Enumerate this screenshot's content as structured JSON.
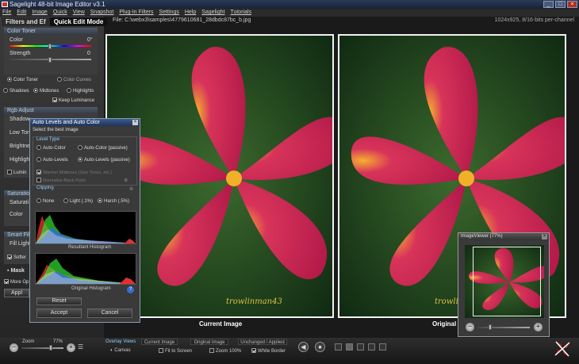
{
  "window": {
    "title": "Sagelight 48-bit Image Editor v3.1",
    "controls": [
      "_",
      "□",
      "×"
    ]
  },
  "menu": [
    "File",
    "Edit",
    "Image",
    "Quick",
    "View",
    "Snapshot",
    "Plug-In Filters",
    "Settings",
    "Help",
    "Sagelight",
    "Tutorials"
  ],
  "file_info": {
    "path": "File: C:\\webx3\\samples\\4779610681_28dbdc87bc_b.jpg",
    "dims": "1024x925, 8/16-bits per-channel"
  },
  "panel": {
    "tabs": [
      "Filters and Ef",
      "Quick Edit Mode"
    ],
    "color_toner": {
      "title": "Color Toner",
      "sliders": [
        {
          "label": "Color",
          "value": "0°"
        },
        {
          "label": "Strength",
          "value": "0"
        }
      ],
      "mode_options": [
        "Color Toner",
        "Color Curves"
      ],
      "tones": [
        "Shadows",
        "Midtones",
        "Highlights"
      ],
      "keep_luminance": "Keep Luminance"
    },
    "rgb_adjust": {
      "title": "Rgb Adjust",
      "items": [
        "Shadow",
        "Low Ton",
        "Brightne",
        "Highlight",
        "Lumin"
      ]
    },
    "saturation": {
      "title": "Saturation",
      "items": [
        "Saturati",
        "Color"
      ]
    },
    "smart_fill": {
      "title": "Smart Fil",
      "items": [
        "Fill Light",
        "Softer"
      ]
    },
    "mask_label": "Mask",
    "more_options": "More Op",
    "apply_label": "Appl"
  },
  "dialog": {
    "title": "Auto Levels and Auto Color",
    "subtitle": "Select the best image",
    "level_type_label": "Level Type",
    "options": [
      "Auto-Color",
      "Auto-Color (passive)",
      "Auto-Levels",
      "Auto-Levels (passive)"
    ],
    "warmer": "Warmer Midtones (Skin Tones, etc.)",
    "normalize": "Normalize Black Point",
    "clipping_label": "Clipping",
    "clipping_options": [
      "None",
      "Light (.1%)",
      "Harsh (.5%)"
    ],
    "resultant_label": "Resultant Histogram",
    "original_label": "Original Histogram",
    "reset": "Reset",
    "accept": "Accept",
    "cancel": "Cancel"
  },
  "images": {
    "left_caption": "Current Image",
    "right_caption": "Original I",
    "watermark": "trowlinman43",
    "watermark_short": "trowlin"
  },
  "viewer": {
    "title": "ImageViewer (77%)",
    "minus": "−",
    "plus": "+"
  },
  "bottom": {
    "zoom_label": "Zoom",
    "zoom_value": "77%",
    "overlay_views": "Overlay Views",
    "canvas": "Canvas",
    "tabs": [
      "Current Image",
      "Original Image",
      "Unchanged / Applied"
    ],
    "fit_to_screen": "Fit to Screen",
    "zoom_100": "Zoom 100%",
    "white_border": "White Border"
  }
}
